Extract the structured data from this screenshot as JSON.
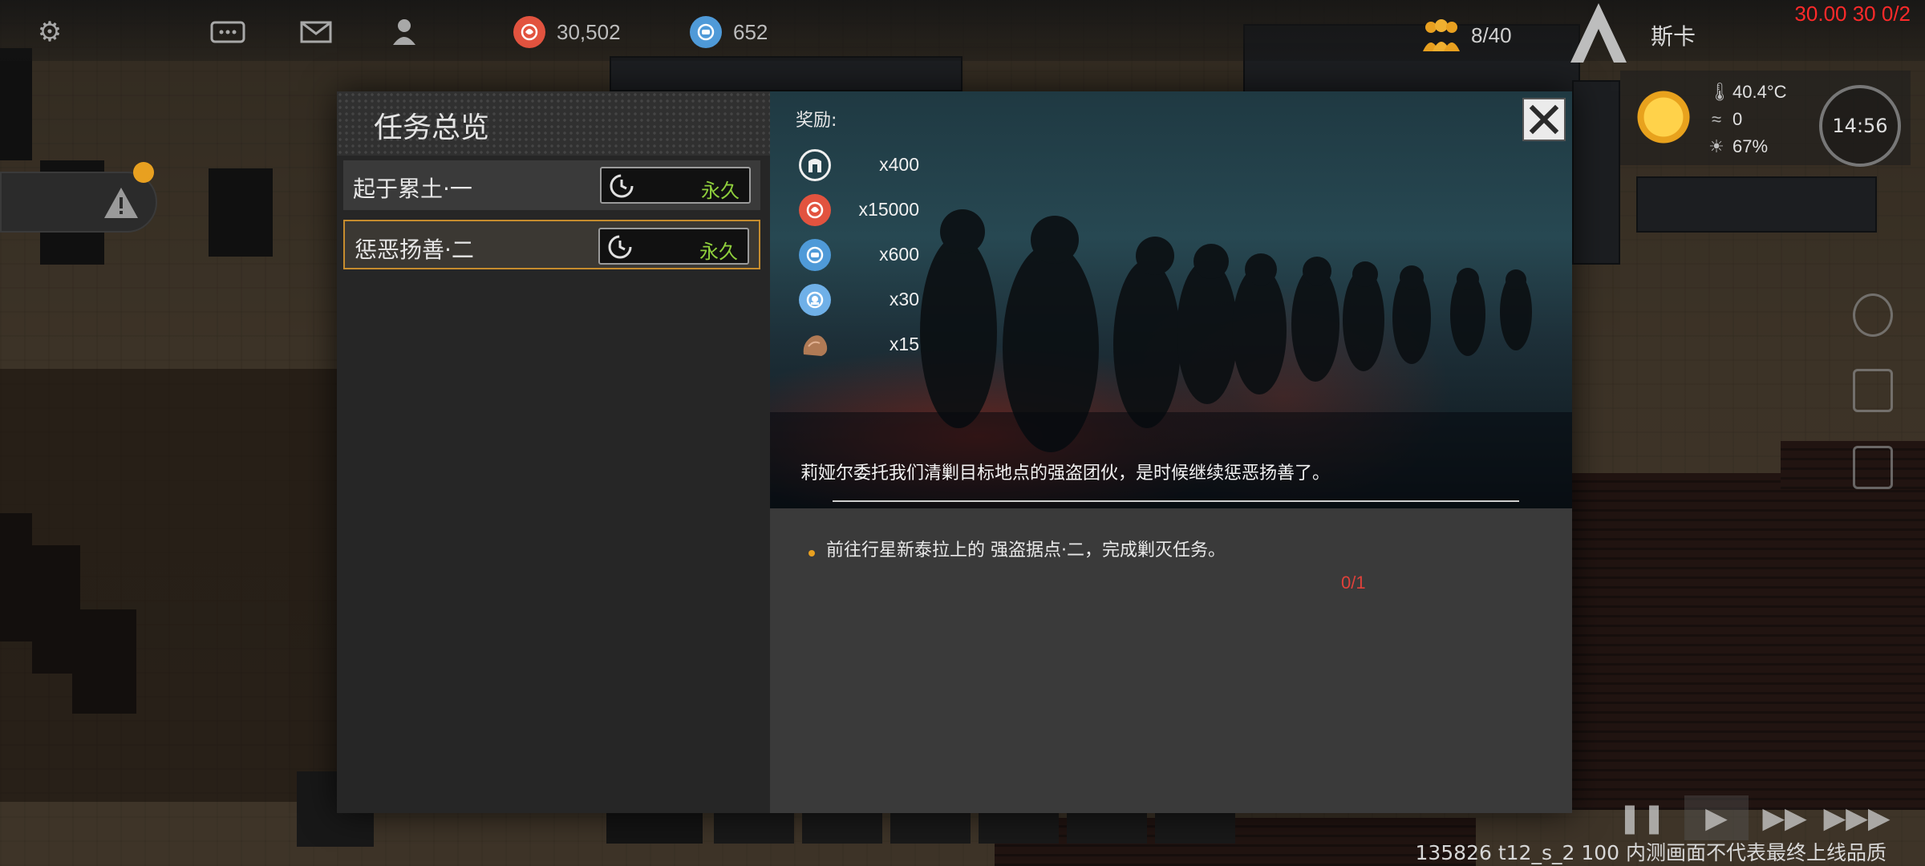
{
  "hud": {
    "resources": [
      {
        "name": "red-coin",
        "value": "30,502",
        "color": "#e2533f"
      },
      {
        "name": "blue-coin",
        "value": "652",
        "color": "#4f9ad8"
      }
    ],
    "population": "8/40",
    "player_name": "斯卡",
    "fps_debug": "30.00 30 0/2"
  },
  "weather": {
    "temperature": "40.4°C",
    "wind": "0",
    "light": "67%",
    "time": "14:56"
  },
  "quest_panel": {
    "title": "任务总览",
    "quests": [
      {
        "name": "起于累土·一",
        "duration": "永久",
        "selected": false
      },
      {
        "name": "惩恶扬善·二",
        "duration": "永久",
        "selected": true
      }
    ],
    "rewards_label": "奖励:",
    "rewards": [
      {
        "icon": "metal-icon",
        "amount": "x400",
        "color": "#f0f0f0"
      },
      {
        "icon": "red-coin-icon",
        "amount": "x15000",
        "color": "#e2533f"
      },
      {
        "icon": "blue-coin-icon",
        "amount": "x600",
        "color": "#4f9ad8"
      },
      {
        "icon": "blue-gear-coin-icon",
        "amount": "x30",
        "color": "#6fb0e8"
      },
      {
        "icon": "ore-icon",
        "amount": "x15",
        "color": "#b07a55"
      }
    ],
    "description": "莉娅尔委托我们清剿目标地点的强盗团伙，是时候继续惩恶扬善了。",
    "objectives": [
      {
        "text": "前往行星新泰拉上的 强盗据点·二，完成剿灭任务。",
        "progress": "0/1"
      }
    ]
  },
  "footer": {
    "build_info": "135826 t12_s_2 100 内测画面不代表最终上线品质"
  },
  "colors": {
    "accent": "#c68c2e",
    "duration_green": "#8fcf3c",
    "progress_red": "#e0413a",
    "fps_red": "#ff2a2a"
  }
}
